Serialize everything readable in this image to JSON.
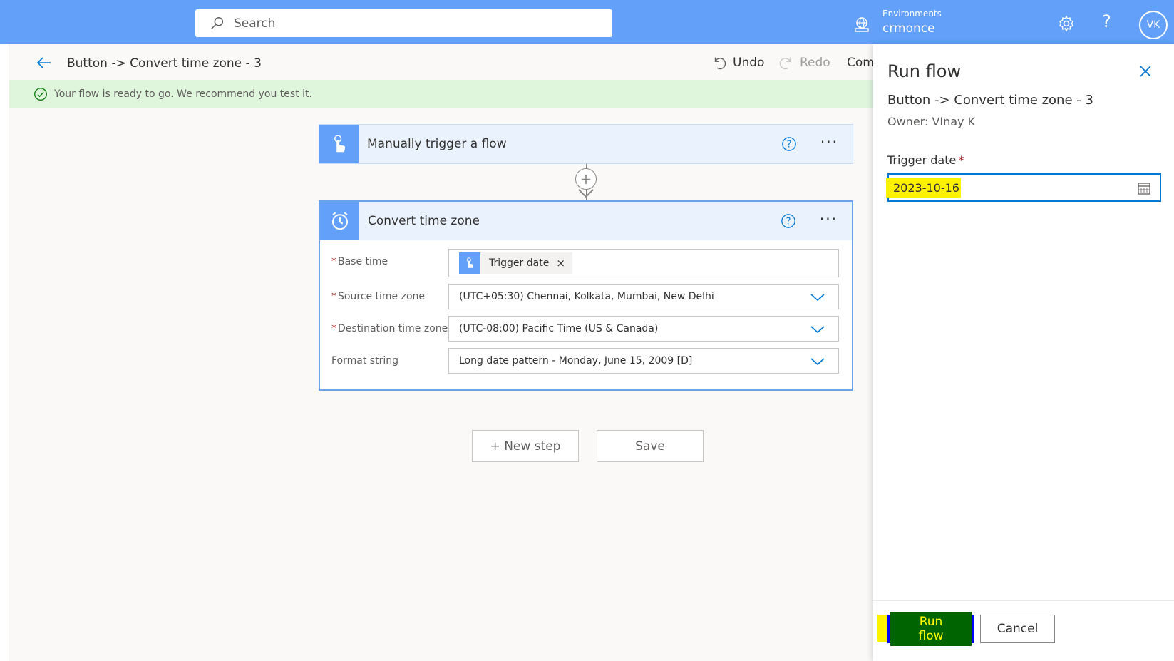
{
  "topbar": {
    "search_placeholder": "Search",
    "environments_label": "Environments",
    "environment_name": "crmonce",
    "help_glyph": "?",
    "avatar_initials": "VK",
    "color": "#62a0f9"
  },
  "commandbar": {
    "flow_title": "Button -> Convert time zone - 3",
    "undo_label": "Undo",
    "redo_label": "Redo",
    "comments_label": "Comments"
  },
  "banner": {
    "message": "Your flow is ready to go. We recommend you test it."
  },
  "trigger_card": {
    "title": "Manually trigger a flow",
    "icon": "touch-hand-icon"
  },
  "action_card": {
    "title": "Convert time zone",
    "icon": "alarm-clock-icon",
    "fields": [
      {
        "label": "Base time",
        "required": true,
        "token_label": "Trigger date",
        "token_remove": "×"
      },
      {
        "label": "Source time zone",
        "required": true,
        "value": "(UTC+05:30) Chennai, Kolkata, Mumbai, New Delhi"
      },
      {
        "label": "Destination time zone",
        "required": true,
        "value": "(UTC-08:00) Pacific Time (US & Canada)"
      },
      {
        "label": "Format string",
        "required": false,
        "value": "Long date pattern - Monday, June 15, 2009 [D]"
      }
    ]
  },
  "canvas_actions": {
    "new_step_label": "+ New step",
    "save_label": "Save",
    "more_glyph": "···",
    "plus_glyph": "+"
  },
  "panel": {
    "title": "Run flow",
    "flow_name": "Button -> Convert time zone - 3",
    "owner": "Owner: VInay K",
    "trigger_date_label": "Trigger date",
    "required_mark": "*",
    "trigger_date_value": "2023-10-16",
    "run_button_label": "Run flow",
    "cancel_button_label": "Cancel"
  }
}
